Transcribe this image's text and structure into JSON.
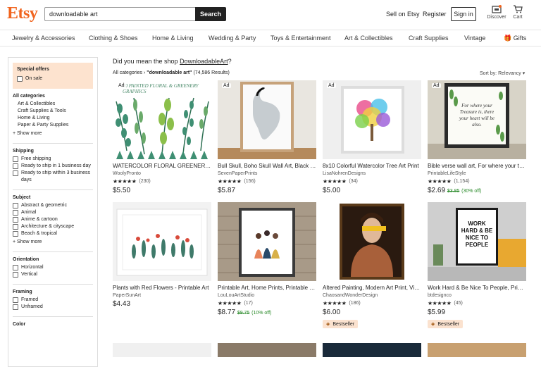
{
  "header": {
    "logo": "Etsy",
    "search_value": "downloadable art",
    "search_button": "Search",
    "sell": "Sell on Etsy",
    "register": "Register",
    "signin": "Sign in",
    "discover": "Discover",
    "cart": "Cart"
  },
  "categories": [
    "Jewelry & Accessories",
    "Clothing & Shoes",
    "Home & Living",
    "Wedding & Party",
    "Toys & Entertainment",
    "Art & Collectibles",
    "Craft Supplies",
    "Vintage",
    "Gifts"
  ],
  "sidebar": {
    "special_title": "Special offers",
    "on_sale": "On sale",
    "allcat_title": "All categories",
    "allcat_items": [
      "Art & Collectibles",
      "Craft Supplies & Tools",
      "Home & Living",
      "Paper & Party Supplies"
    ],
    "show_more": "+ Show more",
    "shipping_title": "Shipping",
    "shipping_items": [
      "Free shipping",
      "Ready to ship in 1 business day",
      "Ready to ship within 3 business days"
    ],
    "subject_title": "Subject",
    "subject_items": [
      "Abstract & geometric",
      "Animal",
      "Anime & cartoon",
      "Architecture & cityscape",
      "Beach & tropical"
    ],
    "orientation_title": "Orientation",
    "orientation_items": [
      "Horizontal",
      "Vertical"
    ],
    "framing_title": "Framing",
    "framing_items": [
      "Framed",
      "Unframed"
    ],
    "color_title": "Color"
  },
  "main": {
    "dym_prefix": "Did you mean the shop ",
    "dym_link": "DownloadableArt",
    "dym_suffix": "?",
    "crumb_root": "All categories",
    "crumb_query": "\"downloadable art\"",
    "crumb_count": "(74,586 Results)",
    "sort": "Sort by: Relevancy",
    "ad_label": "Ad",
    "bestseller": "Bestseller",
    "listings": [
      {
        "title": "WATERCOLOR FLORAL GREENERY clipart",
        "shop": "WoolyPronto",
        "reviews": "(230)",
        "price": "$5.50",
        "ad": true,
        "img_text": "30 PAINTED FLORAL & GREENERY GRAPHICS"
      },
      {
        "title": "Bull Skull, Boho Skull Wall Art, Black and White",
        "shop": "SevenPaperPrints",
        "reviews": "(156)",
        "price": "$5.87",
        "ad": true
      },
      {
        "title": "8x10 Colorful Watercolor Tree Art Print",
        "shop": "LisaNohrenDesigns",
        "reviews": "(34)",
        "price": "$5.00",
        "ad": true
      },
      {
        "title": "Bible verse wall art, For where your treasure is",
        "shop": "PrintableLifeStyle",
        "reviews": "(1,154)",
        "price": "$2.69",
        "old": "$3.85",
        "disc": "(30% off)",
        "ad": true,
        "img_text": "For where your Treasure is, there your heart will be also."
      },
      {
        "title": "Plants with Red Flowers - Printable Art",
        "shop": "PaperSunArt",
        "reviews": "",
        "price": "$4.43"
      },
      {
        "title": "Printable Art, Home Prints, Printable Wall Art",
        "shop": "LouLouArtStudio",
        "reviews": "(17)",
        "price": "$8.77",
        "old": "$9.75",
        "disc": "(10% off)"
      },
      {
        "title": "Altered Painting, Modern Art Print, Vintage",
        "shop": "ChaosandWonderDesign",
        "reviews": "(186)",
        "price": "$6.00",
        "best": true
      },
      {
        "title": "Work Hard & Be Nice To People, Printable",
        "shop": "btdesignco",
        "reviews": "(45)",
        "price": "$5.99",
        "best": true,
        "img_text": "WORK HARD & BE NICE TO PEOPLE"
      }
    ]
  }
}
